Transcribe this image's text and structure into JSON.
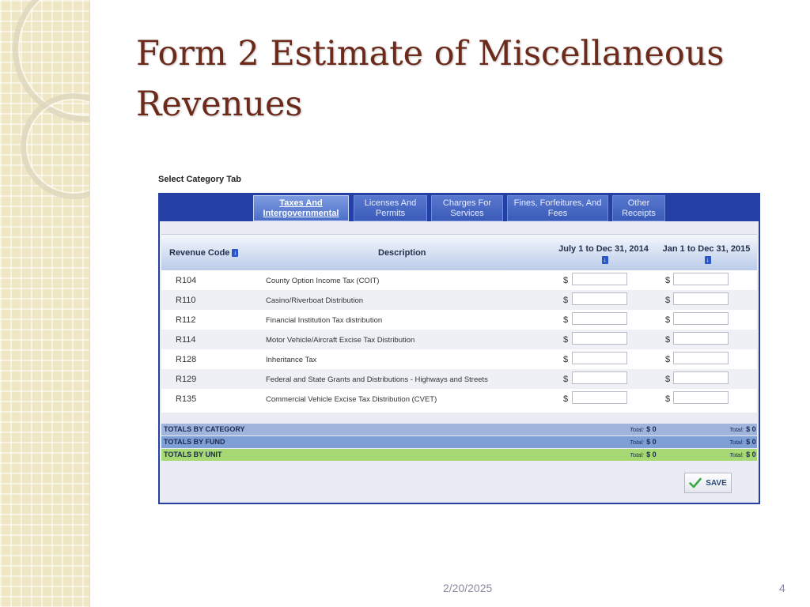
{
  "slide": {
    "title": "Form 2 Estimate of Miscellaneous Revenues",
    "date": "2/20/2025",
    "page_number": "4"
  },
  "form": {
    "select_label": "Select Category Tab",
    "tabs": [
      {
        "label": "Taxes And Intergovernmental",
        "active": true
      },
      {
        "label": "Licenses And Permits",
        "active": false
      },
      {
        "label": "Charges For Services",
        "active": false
      },
      {
        "label": "Fines, Forfeitures, And Fees",
        "active": false
      },
      {
        "label": "Other Receipts",
        "active": false
      }
    ],
    "columns": {
      "code": "Revenue Code",
      "description": "Description",
      "period1": "July 1 to Dec 31, 2014",
      "period2": "Jan 1 to Dec 31, 2015"
    },
    "currency_symbol": "$",
    "rows": [
      {
        "code": "R104",
        "description": "County Option Income Tax (COIT)",
        "period1": "",
        "period2": ""
      },
      {
        "code": "R110",
        "description": "Casino/Riverboat Distribution",
        "period1": "",
        "period2": ""
      },
      {
        "code": "R112",
        "description": "Financial Institution Tax distribution",
        "period1": "",
        "period2": ""
      },
      {
        "code": "R114",
        "description": "Motor Vehicle/Aircraft Excise Tax Distribution",
        "period1": "",
        "period2": ""
      },
      {
        "code": "R128",
        "description": "Inheritance Tax",
        "period1": "",
        "period2": ""
      },
      {
        "code": "R129",
        "description": "Federal and State Grants and Distributions - Highways and Streets",
        "period1": "",
        "period2": ""
      },
      {
        "code": "R135",
        "description": "Commercial Vehicle Excise Tax Distribution (CVET)",
        "period1": "",
        "period2": ""
      }
    ],
    "totals_prefix": "Total:",
    "totals": [
      {
        "label": "TOTALS BY CATEGORY",
        "period1": "$ 0",
        "period2": "$ 0"
      },
      {
        "label": "TOTALS BY FUND",
        "period1": "$ 0",
        "period2": "$ 0"
      },
      {
        "label": "TOTALS BY UNIT",
        "period1": "$ 0",
        "period2": "$ 0"
      }
    ],
    "save_label": "SAVE"
  },
  "colors": {
    "title": "#6b2a1a",
    "panel_border": "#2440a5",
    "totals_category": "#9fb5dc",
    "totals_fund": "#7e9fd6",
    "totals_unit": "#a6d873",
    "save_check": "#3aa845"
  },
  "icons": [
    "sort-icon",
    "check-icon"
  ]
}
